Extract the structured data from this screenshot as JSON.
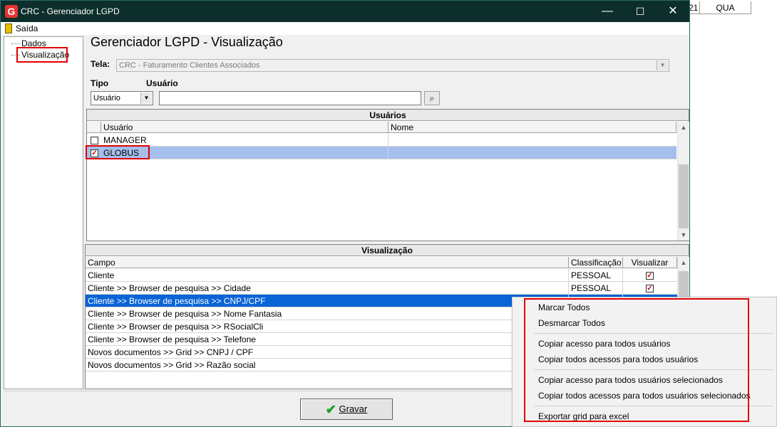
{
  "background": {
    "col1": "21",
    "col2": "QUA"
  },
  "window": {
    "title": "CRC - Gerenciador LGPD",
    "logo": "G",
    "minimize": "—",
    "maximize": "☐",
    "close": "✕"
  },
  "menu": {
    "exit_label": "Saída"
  },
  "tree": {
    "items": [
      "Dados",
      "Visualização"
    ]
  },
  "header": {
    "title": "Gerenciador LGPD - Visualização"
  },
  "form": {
    "tela_label": "Tela:",
    "tela_value": "CRC - Faturamento Clientes Associados",
    "tipo_label": "Tipo",
    "usuario_label": "Usuário",
    "tipo_value": "Usuário",
    "usuario_value": ""
  },
  "users_grid": {
    "title": "Usuários",
    "columns": [
      "Usuário",
      "Nome"
    ],
    "rows": [
      {
        "checked": false,
        "user": "MANAGER",
        "name": ""
      },
      {
        "checked": true,
        "user": "GLOBUS",
        "name": ""
      }
    ]
  },
  "view_grid": {
    "title": "Visualização",
    "columns": [
      "Campo",
      "Classificação",
      "Visualizar"
    ],
    "rows": [
      {
        "campo": "Cliente",
        "classificacao": "PESSOAL",
        "visualizar": true
      },
      {
        "campo": "Cliente >> Browser de pesquisa >> Cidade",
        "classificacao": "PESSOAL",
        "visualizar": true
      },
      {
        "campo": "Cliente >> Browser de pesquisa >> CNPJ/CPF",
        "classificacao": "",
        "visualizar": false
      },
      {
        "campo": "Cliente >> Browser de pesquisa >> Nome Fantasia",
        "classificacao": "",
        "visualizar": false
      },
      {
        "campo": "Cliente >> Browser de pesquisa >> RSocialCli",
        "classificacao": "",
        "visualizar": false
      },
      {
        "campo": "Cliente >> Browser de pesquisa >> Telefone",
        "classificacao": "",
        "visualizar": false
      },
      {
        "campo": "Novos documentos >> Grid >> CNPJ / CPF",
        "classificacao": "",
        "visualizar": false
      },
      {
        "campo": "Novos documentos >> Grid >> Razão social",
        "classificacao": "",
        "visualizar": false
      }
    ]
  },
  "actions": {
    "save_label": "Gravar"
  },
  "context_menu": {
    "items": [
      "Marcar Todos",
      "Desmarcar Todos",
      "Copiar acesso para todos usuários",
      "Copiar todos acessos para todos usuários",
      "Copiar acesso para todos usuários selecionados",
      "Copiar todos acessos para todos usuários selecionados",
      "Exportar grid para excel"
    ]
  },
  "colors": {
    "highlight": "#0a64d6",
    "selected_row": "#a4bfeb",
    "annotation": "#e00000",
    "titlebar": "#0d2f2b"
  }
}
